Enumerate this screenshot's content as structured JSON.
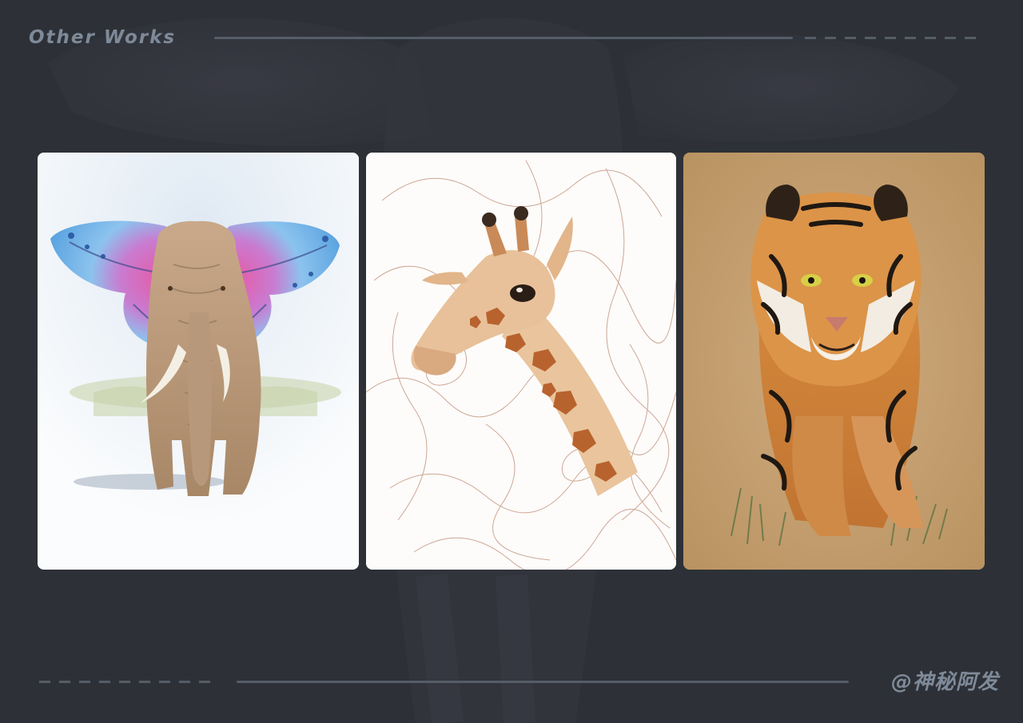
{
  "header": {
    "title": "Other Works"
  },
  "footer": {
    "signature": "@神秘阿发"
  },
  "gallery": {
    "items": [
      {
        "subject": "elephant-with-butterfly-wings",
        "paper": "white"
      },
      {
        "subject": "scribble-line-giraffe",
        "paper": "white"
      },
      {
        "subject": "tiger-on-kraft-paper",
        "paper": "kraft"
      }
    ]
  },
  "colors": {
    "background": "#2d3137",
    "text": "#7f8a99",
    "rule": "#555d68",
    "kraft_paper": "#c8a274"
  }
}
